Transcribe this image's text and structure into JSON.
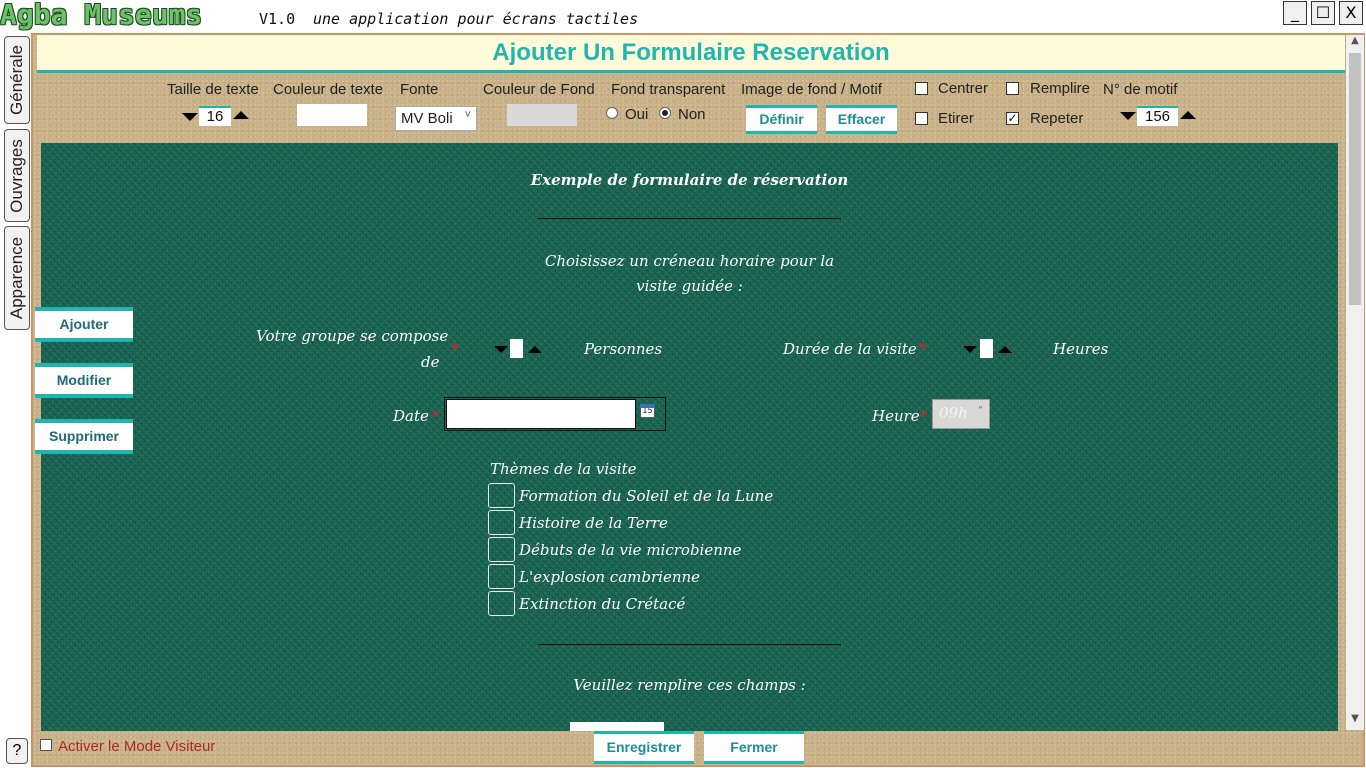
{
  "app": {
    "name": "Agba Museums",
    "version": "V1.0",
    "tagline": "une application pour écrans tactiles"
  },
  "window_controls": {
    "minimize": "_",
    "maximize": "☐",
    "close": "X"
  },
  "side_tabs": [
    "Générale",
    "Ouvrages",
    "Apparence"
  ],
  "help_label": "?",
  "page_title": "Ajouter Un Formulaire Reservation",
  "toolbar": {
    "text_size_label": "Taille de texte",
    "text_size_value": "16",
    "text_color_label": "Couleur de texte",
    "text_color_value": "#ffffff",
    "font_label": "Fonte",
    "font_value": "MV Boli",
    "bg_color_label": "Couleur de Fond",
    "bg_color_value": "#d9d9d9",
    "transparent_label": "Fond transparent",
    "transparent_yes": "Oui",
    "transparent_no": "Non",
    "transparent_selected": "Non",
    "bg_image_label": "Image de fond / Motif",
    "define_button": "Définir",
    "clear_button": "Effacer",
    "center_label": "Centrer",
    "stretch_label": "Etirer",
    "fill_label": "Remplire",
    "repeat_label": "Repeter",
    "repeat_checked": true,
    "pattern_label": "N° de motif",
    "pattern_value": "156"
  },
  "side_buttons": {
    "add": "Ajouter",
    "modify": "Modifier",
    "delete": "Supprimer"
  },
  "form": {
    "title": "Exemple de formulaire de réservation",
    "slot_prompt_line1": "Choisissez un créneau horaire pour la",
    "slot_prompt_line2": "visite guidée :",
    "group_label_line1": "Votre groupe se compose",
    "group_label_line2": "de",
    "required_mark": "*",
    "persons_unit": "Personnes",
    "duration_label": "Durée de la visite",
    "hours_unit": "Heures",
    "date_label": "Date",
    "date_value": "",
    "calendar_day": "15",
    "hour_label": "Heure",
    "hour_value": "09h",
    "themes_label": "Thèmes de la visite",
    "themes": [
      "Formation du Soleil et de la Lune",
      "Histoire de la Terre",
      "Débuts de la vie microbienne",
      "L'explosion cambrienne",
      "Extinction du Crétacé"
    ],
    "fill_prompt": "Veuillez remplire ces champs :"
  },
  "footer": {
    "visitor_mode_label": "Activer le Mode Visiteur",
    "save_button": "Enregistrer",
    "close_button": "Fermer"
  }
}
